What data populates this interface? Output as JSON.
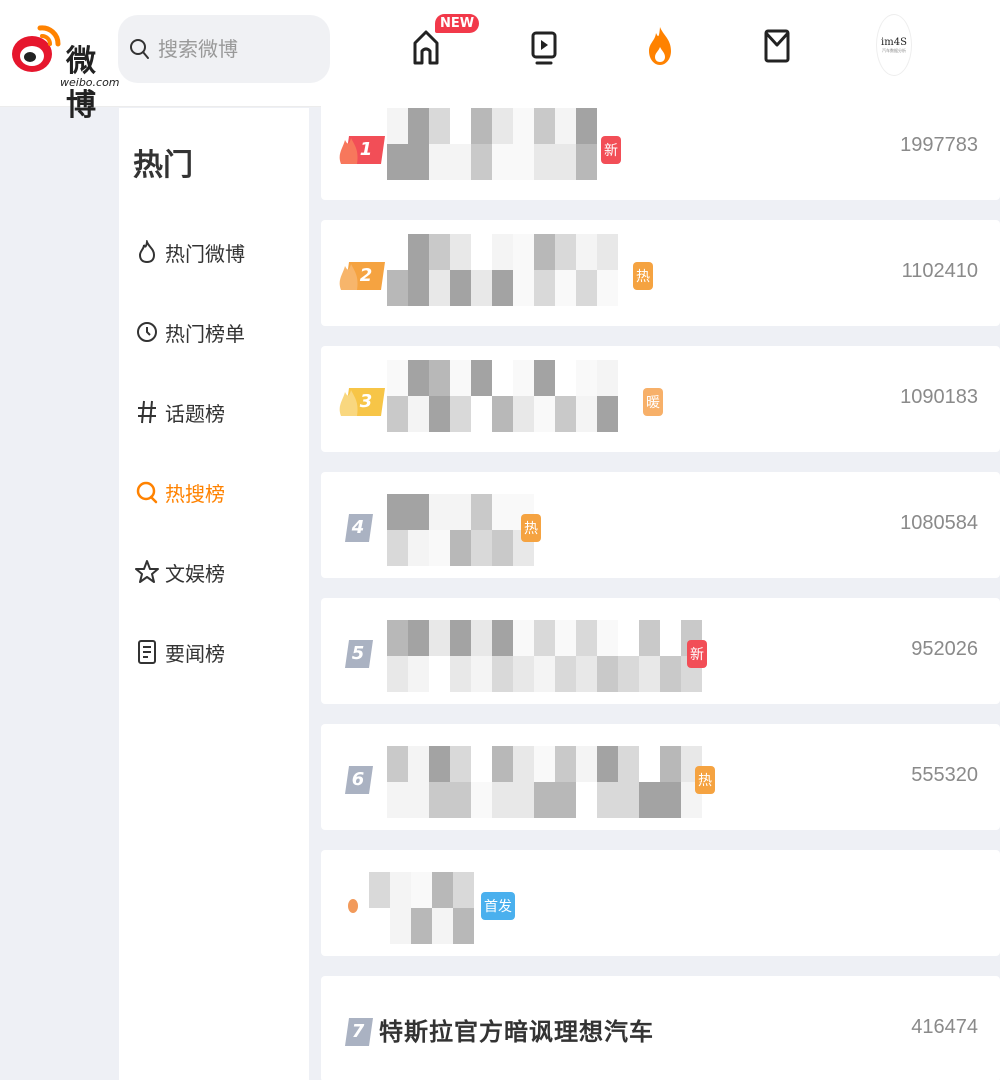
{
  "header": {
    "logo_text": "微博",
    "logo_sub": "weibo.com",
    "search_placeholder": "搜索微博",
    "new_badge": "NEW",
    "avatar_text": "im4S",
    "avatar_sub": "汽车数据分析",
    "nav": [
      {
        "name": "home",
        "icon": "home-icon"
      },
      {
        "name": "video",
        "icon": "video-icon"
      },
      {
        "name": "hot",
        "icon": "flame-icon",
        "active": true
      },
      {
        "name": "messages",
        "icon": "mail-icon"
      }
    ],
    "accent": "#ff8200"
  },
  "sidebar": {
    "title": "热门",
    "items": [
      {
        "label": "热门微博",
        "icon": "flame-outline-icon"
      },
      {
        "label": "热门榜单",
        "icon": "clock-icon"
      },
      {
        "label": "话题榜",
        "icon": "hashtag-icon"
      },
      {
        "label": "热搜榜",
        "icon": "search-icon",
        "active": true
      },
      {
        "label": "文娱榜",
        "icon": "star-icon"
      },
      {
        "label": "要闻榜",
        "icon": "news-icon"
      }
    ]
  },
  "list": [
    {
      "rank": "1",
      "tag": "新",
      "tag_type": "new",
      "count": "1997783"
    },
    {
      "rank": "2",
      "tag": "热",
      "tag_type": "hot",
      "count": "1102410"
    },
    {
      "rank": "3",
      "tag": "暖",
      "tag_type": "warm",
      "count": "1090183"
    },
    {
      "rank": "4",
      "tag": "热",
      "tag_type": "hot",
      "count": "1080584"
    },
    {
      "rank": "5",
      "tag": "新",
      "tag_type": "new",
      "count": "952026"
    },
    {
      "rank": "6",
      "tag": "热",
      "tag_type": "hot",
      "count": "555320"
    },
    {
      "rank": "",
      "tag": "首发",
      "tag_type": "first",
      "count": ""
    },
    {
      "rank": "7",
      "title": "特斯拉官方暗讽理想汽车",
      "count": "416474"
    }
  ]
}
